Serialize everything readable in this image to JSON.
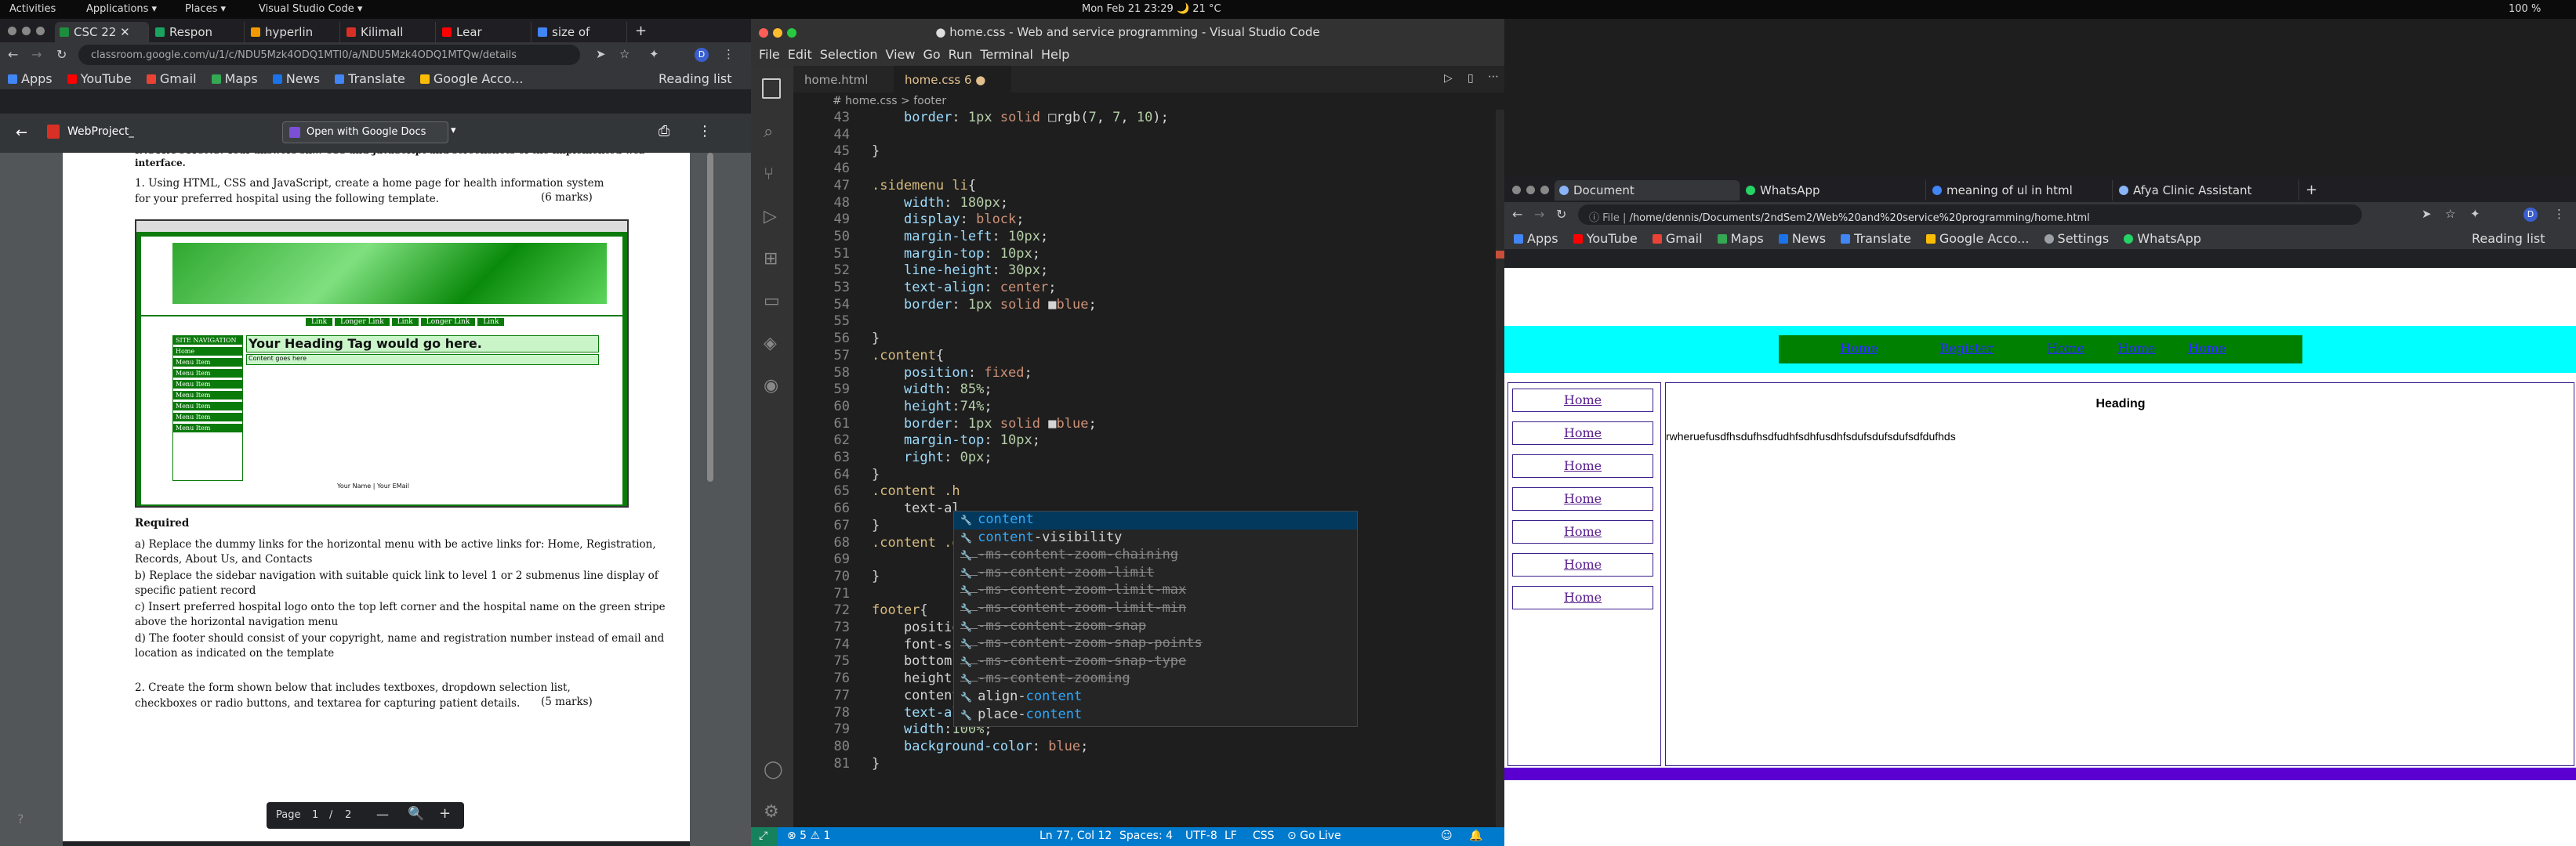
{
  "topbar": {
    "activities": "Activities",
    "applications": "Applications ▾",
    "places": "Places ▾",
    "vscode": "Visual Studio Code ▾",
    "clock": "Mon Feb 21  23:29  🌙 21 °C",
    "battery": "100 %"
  },
  "left_chrome": {
    "tabs": [
      "CSC 22",
      "Respon",
      "hyperlin",
      "Kilimall",
      "Lear",
      "size of"
    ],
    "url": "classroom.google.com/u/1/c/NDU5Mzk4ODQ1MTI0/a/NDU5Mzk4ODQ1MTQw/details",
    "bookmarks": [
      "Apps",
      "YouTube",
      "Gmail",
      "Maps",
      "News",
      "Translate",
      "Google Acco..."
    ],
    "reading_list": "Reading list",
    "pdf_title": "WebProject_",
    "open_with": "Open with Google Docs",
    "page_label": "Page",
    "page_num": "1",
    "page_sep": "/",
    "page_total": "2"
  },
  "pdf": {
    "intro": "INSTRUCTIONS: Your answers sh... CSS and JavaScript and screenshots of the implemented web interface.",
    "q1": "1.   Using HTML, CSS and JavaScript, create a home page for health information system for your preferred hospital using the following template.",
    "q1_marks": "(6 marks)",
    "tpl_links": [
      "Link",
      "Longer Link",
      "Link",
      "Longer Link",
      "Link"
    ],
    "tpl_nav_title": "SITE NAVIGATION",
    "tpl_nav_items": [
      "Home",
      "Menu Item",
      "Menu Item",
      "Menu Item",
      "Menu Item",
      "Menu Item",
      "Menu Item",
      "Menu Item"
    ],
    "tpl_heading": "Your Heading Tag would go here.",
    "tpl_content": "Content goes here",
    "tpl_footer": "Your Name | Your EMail",
    "required": "Required",
    "items": [
      "a)  Replace the dummy links for the horizontal menu with be active links for: Home, Registration, Records, About Us, and Contacts",
      "b)  Replace the sidebar navigation with suitable quick link to level 1 or 2 submenus line display of specific patient record",
      "c)  Insert preferred hospital logo onto the top left corner and the hospital name on the green stripe above the horizontal navigation menu",
      "d)  The footer should consist of your copyright, name and registration number instead of email and location as indicated on the template"
    ],
    "q2": "2.   Create the form shown below that includes textboxes, dropdown selection list, checkboxes or radio buttons, and textarea for capturing patient details.",
    "q2_marks": "(5 marks)"
  },
  "vscode": {
    "title": "● home.css - Web and service programming - Visual Studio Code",
    "menu": [
      "File",
      "Edit",
      "Selection",
      "View",
      "Go",
      "Run",
      "Terminal",
      "Help"
    ],
    "tabs": [
      "home.html",
      "home.css 6 ●"
    ],
    "breadcrumb": "# home.css  >  footer",
    "lines": [
      {
        "n": "43",
        "t": "    border: 1px solid □rgb(7, 7, 10);"
      },
      {
        "n": "44",
        "t": ""
      },
      {
        "n": "45",
        "t": "}"
      },
      {
        "n": "46",
        "t": ""
      },
      {
        "n": "47",
        "t": ".sidemenu li{"
      },
      {
        "n": "48",
        "t": "    width: 180px;"
      },
      {
        "n": "49",
        "t": "    display: block;"
      },
      {
        "n": "50",
        "t": "    margin-left: 10px;"
      },
      {
        "n": "51",
        "t": "    margin-top: 10px;"
      },
      {
        "n": "52",
        "t": "    line-height: 30px;"
      },
      {
        "n": "53",
        "t": "    text-align: center;"
      },
      {
        "n": "54",
        "t": "    border: 1px solid ■blue;"
      },
      {
        "n": "55",
        "t": ""
      },
      {
        "n": "56",
        "t": "}"
      },
      {
        "n": "57",
        "t": ".content{"
      },
      {
        "n": "58",
        "t": "    position: fixed;"
      },
      {
        "n": "59",
        "t": "    width: 85%;"
      },
      {
        "n": "60",
        "t": "    height:74%;"
      },
      {
        "n": "61",
        "t": "    border: 1px solid ■blue;"
      },
      {
        "n": "62",
        "t": "    margin-top: 10px;"
      },
      {
        "n": "63",
        "t": "    right: 0px;"
      },
      {
        "n": "64",
        "t": "}"
      },
      {
        "n": "65",
        "t": ".content .h"
      },
      {
        "n": "66",
        "t": "    text-al"
      },
      {
        "n": "67",
        "t": "}"
      },
      {
        "n": "68",
        "t": ".content .d"
      },
      {
        "n": "69",
        "t": ""
      },
      {
        "n": "70",
        "t": "}"
      },
      {
        "n": "71",
        "t": ""
      },
      {
        "n": "72",
        "t": "footer{"
      },
      {
        "n": "73",
        "t": "    positio"
      },
      {
        "n": "74",
        "t": "    font-si"
      },
      {
        "n": "75",
        "t": "    bottom"
      },
      {
        "n": "76",
        "t": "    height"
      },
      {
        "n": "77",
        "t": "    content"
      },
      {
        "n": "78",
        "t": "    text-align: center;"
      },
      {
        "n": "79",
        "t": "    width:100%;"
      },
      {
        "n": "80",
        "t": "    background-color: blue;"
      },
      {
        "n": "81",
        "t": "}"
      }
    ],
    "suggestions": [
      {
        "pre": "",
        "hl": "content",
        "post": "",
        "sel": true,
        "dep": false
      },
      {
        "pre": "",
        "hl": "content",
        "post": "-visibility",
        "sel": false,
        "dep": false
      },
      {
        "pre": "-ms-content-zoom-chaining",
        "hl": "",
        "post": "",
        "sel": false,
        "dep": true
      },
      {
        "pre": "-ms-content-zoom-limit",
        "hl": "",
        "post": "",
        "sel": false,
        "dep": true
      },
      {
        "pre": "-ms-content-zoom-limit-max",
        "hl": "",
        "post": "",
        "sel": false,
        "dep": true
      },
      {
        "pre": "-ms-content-zoom-limit-min",
        "hl": "",
        "post": "",
        "sel": false,
        "dep": true
      },
      {
        "pre": "-ms-content-zoom-snap",
        "hl": "",
        "post": "",
        "sel": false,
        "dep": true
      },
      {
        "pre": "-ms-content-zoom-snap-points",
        "hl": "",
        "post": "",
        "sel": false,
        "dep": true
      },
      {
        "pre": "-ms-content-zoom-snap-type",
        "hl": "",
        "post": "",
        "sel": false,
        "dep": true
      },
      {
        "pre": "-ms-content-zooming",
        "hl": "",
        "post": "",
        "sel": false,
        "dep": true
      },
      {
        "pre": "align-",
        "hl": "content",
        "post": "",
        "sel": false,
        "dep": false
      },
      {
        "pre": "place-",
        "hl": "content",
        "post": "",
        "sel": false,
        "dep": false
      }
    ],
    "status": {
      "problems": "⊗ 5 ⚠ 1",
      "position": "Ln 77, Col 12",
      "spaces": "Spaces: 4",
      "encoding": "UTF-8",
      "eol": "LF",
      "lang": "CSS",
      "golive": "⊙ Go Live"
    }
  },
  "right_chrome": {
    "tabs": [
      "Document",
      "WhatsApp",
      "meaning of ul in html",
      "Afya Clinic Assistant"
    ],
    "url": "/home/dennis/Documents/2ndSem2/Web%20and%20service%20programming/home.html",
    "url_prefix": "File",
    "bookmarks": [
      "Apps",
      "YouTube",
      "Gmail",
      "Maps",
      "News",
      "Translate",
      "Google Acco...",
      "Settings",
      "WhatsApp"
    ],
    "reading_list": "Reading list"
  },
  "webpage": {
    "nav": [
      "Home",
      "Register",
      "Home",
      "Home",
      "Home"
    ],
    "side": [
      "Home",
      "Home",
      "Home",
      "Home",
      "Home",
      "Home",
      "Home"
    ],
    "heading": "Heading",
    "text": "rwheruefusdfhsdufhsdfudhfsdhfusdhfsdufsdufsdufsdfdufhds",
    "colors": {
      "cyan": "#00ffff",
      "green": "#008000",
      "blue": "#0000ff",
      "purple": "#5a00d0"
    }
  }
}
